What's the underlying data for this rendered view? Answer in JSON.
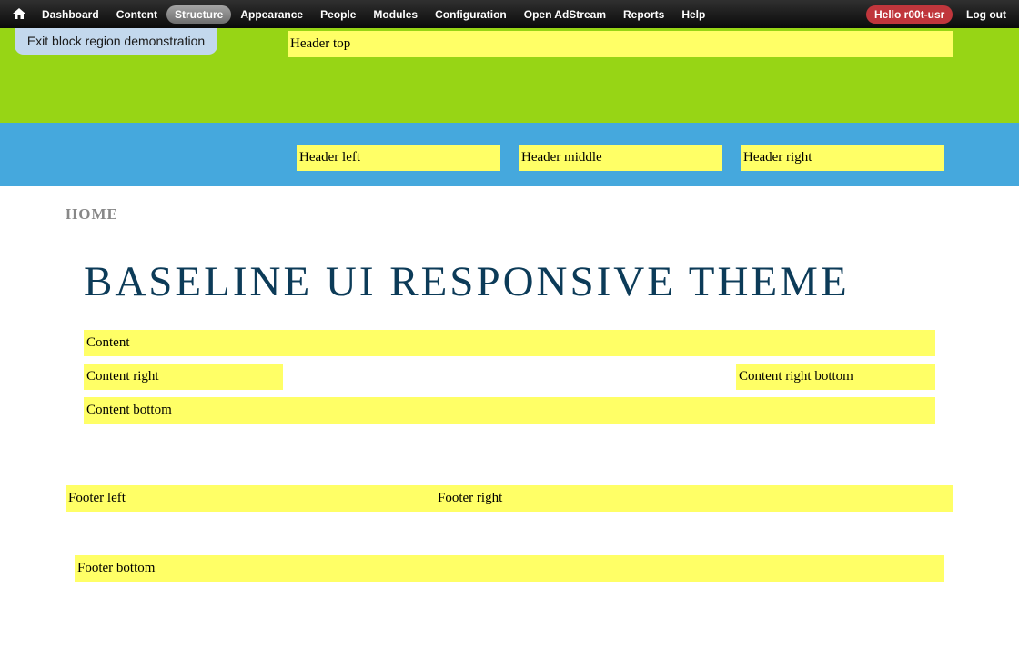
{
  "toolbar": {
    "menu": [
      {
        "label": "Dashboard"
      },
      {
        "label": "Content"
      },
      {
        "label": "Structure"
      },
      {
        "label": "Appearance"
      },
      {
        "label": "People"
      },
      {
        "label": "Modules"
      },
      {
        "label": "Configuration"
      },
      {
        "label": "Open AdStream"
      },
      {
        "label": "Reports"
      },
      {
        "label": "Help"
      }
    ],
    "active_item": "Structure",
    "user_label": "Hello r00t-usr",
    "logout_label": "Log out"
  },
  "exit_demo_label": "Exit block region demonstration",
  "regions": {
    "header_top": "Header top",
    "header_left": "Header left",
    "header_middle": "Header middle",
    "header_right": "Header right",
    "content": "Content",
    "content_right": "Content right",
    "content_right_bottom": "Content right bottom",
    "content_bottom": "Content bottom",
    "footer_left": "Footer left",
    "footer_right": "Footer right",
    "footer_bottom": "Footer bottom"
  },
  "breadcrumb": "HOME",
  "site_title": "BASELINE UI RESPONSIVE THEME",
  "colors": {
    "toolbar_bg": "#1a1a1a",
    "user_badge": "#c0363c",
    "header_top_band": "#97d515",
    "header_band": "#45a8dd",
    "region_highlight": "#ffff66",
    "title_color": "#0c3b58"
  }
}
